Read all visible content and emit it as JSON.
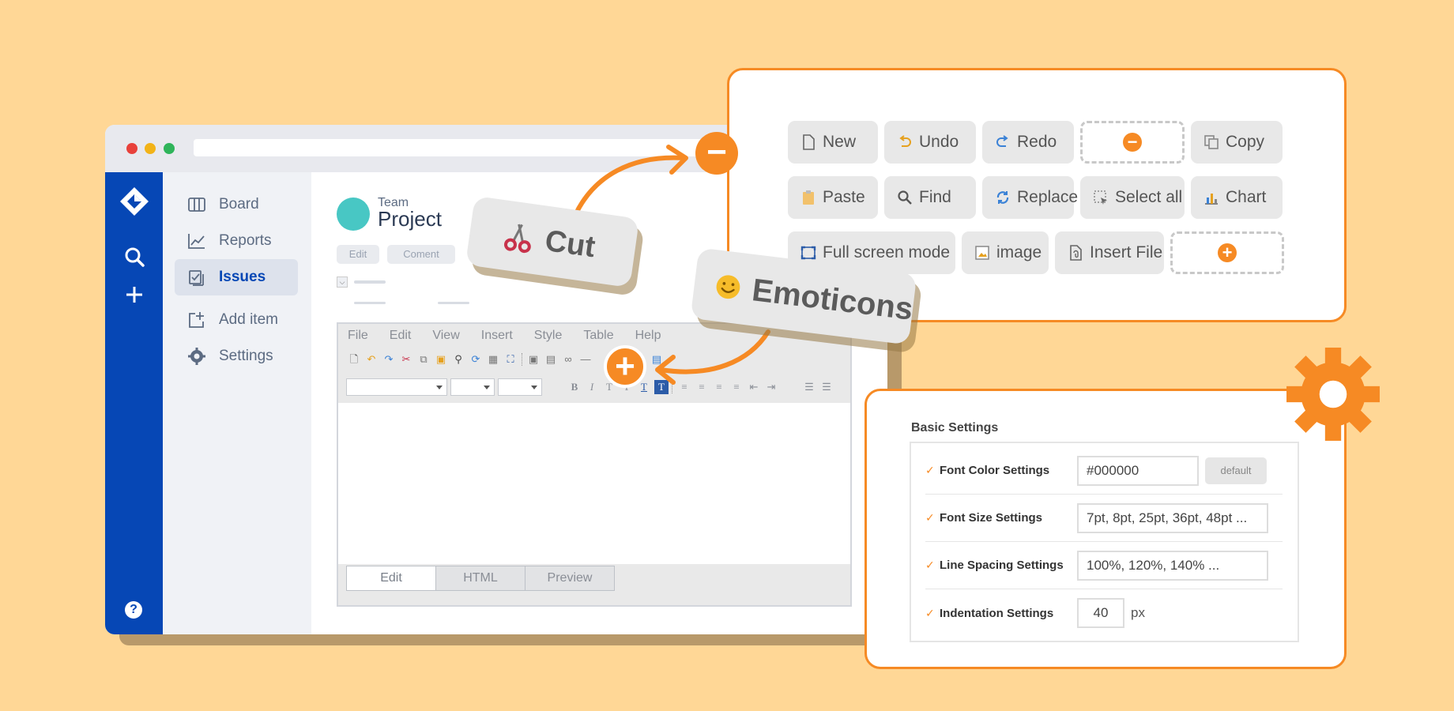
{
  "sidebar": {
    "items": [
      {
        "label": "Board",
        "icon": "board-icon"
      },
      {
        "label": "Reports",
        "icon": "reports-icon"
      },
      {
        "label": "Issues",
        "icon": "issues-icon",
        "active": true
      },
      {
        "label": "Add item",
        "icon": "add-item-icon"
      },
      {
        "label": "Settings",
        "icon": "settings-icon"
      }
    ]
  },
  "project": {
    "team_label": "Team",
    "title": "Project",
    "edit_label": "Edit",
    "comment_label": "Coment"
  },
  "editor": {
    "menu": [
      "File",
      "Edit",
      "View",
      "Insert",
      "Style",
      "Table",
      "Help"
    ],
    "tabs": [
      {
        "label": "Edit",
        "active": true
      },
      {
        "label": "HTML"
      },
      {
        "label": "Preview"
      }
    ]
  },
  "tags": {
    "cut": "Cut",
    "emoticons": "Emoticons"
  },
  "toolbar_panel": {
    "buttons": [
      {
        "label": "New",
        "icon": "new-file-icon"
      },
      {
        "label": "Undo",
        "icon": "undo-icon"
      },
      {
        "label": "Redo",
        "icon": "redo-icon"
      },
      {
        "label": "Copy",
        "icon": "copy-icon"
      },
      {
        "label": "Paste",
        "icon": "paste-icon"
      },
      {
        "label": "Find",
        "icon": "find-icon"
      },
      {
        "label": "Replace",
        "icon": "replace-icon"
      },
      {
        "label": "Select all",
        "icon": "select-all-icon"
      },
      {
        "label": "Chart",
        "icon": "chart-icon"
      },
      {
        "label": "Full screen mode",
        "icon": "fullscreen-icon"
      },
      {
        "label": "image",
        "icon": "image-icon"
      },
      {
        "label": "Insert File",
        "icon": "insert-file-icon"
      }
    ]
  },
  "settings": {
    "title": "Basic Settings",
    "rows": [
      {
        "label": "Font Color Settings",
        "value": "#000000",
        "button": "default"
      },
      {
        "label": "Font Size Settings",
        "value": "7pt, 8pt, 25pt, 36pt, 48pt ..."
      },
      {
        "label": "Line Spacing Settings",
        "value": "100%, 120%, 140% ..."
      },
      {
        "label": "Indentation Settings",
        "value": "40",
        "unit": "px"
      }
    ]
  },
  "colors": {
    "background": "#FFD796",
    "accent": "#F68A24",
    "brand_blue": "#0647B5"
  }
}
